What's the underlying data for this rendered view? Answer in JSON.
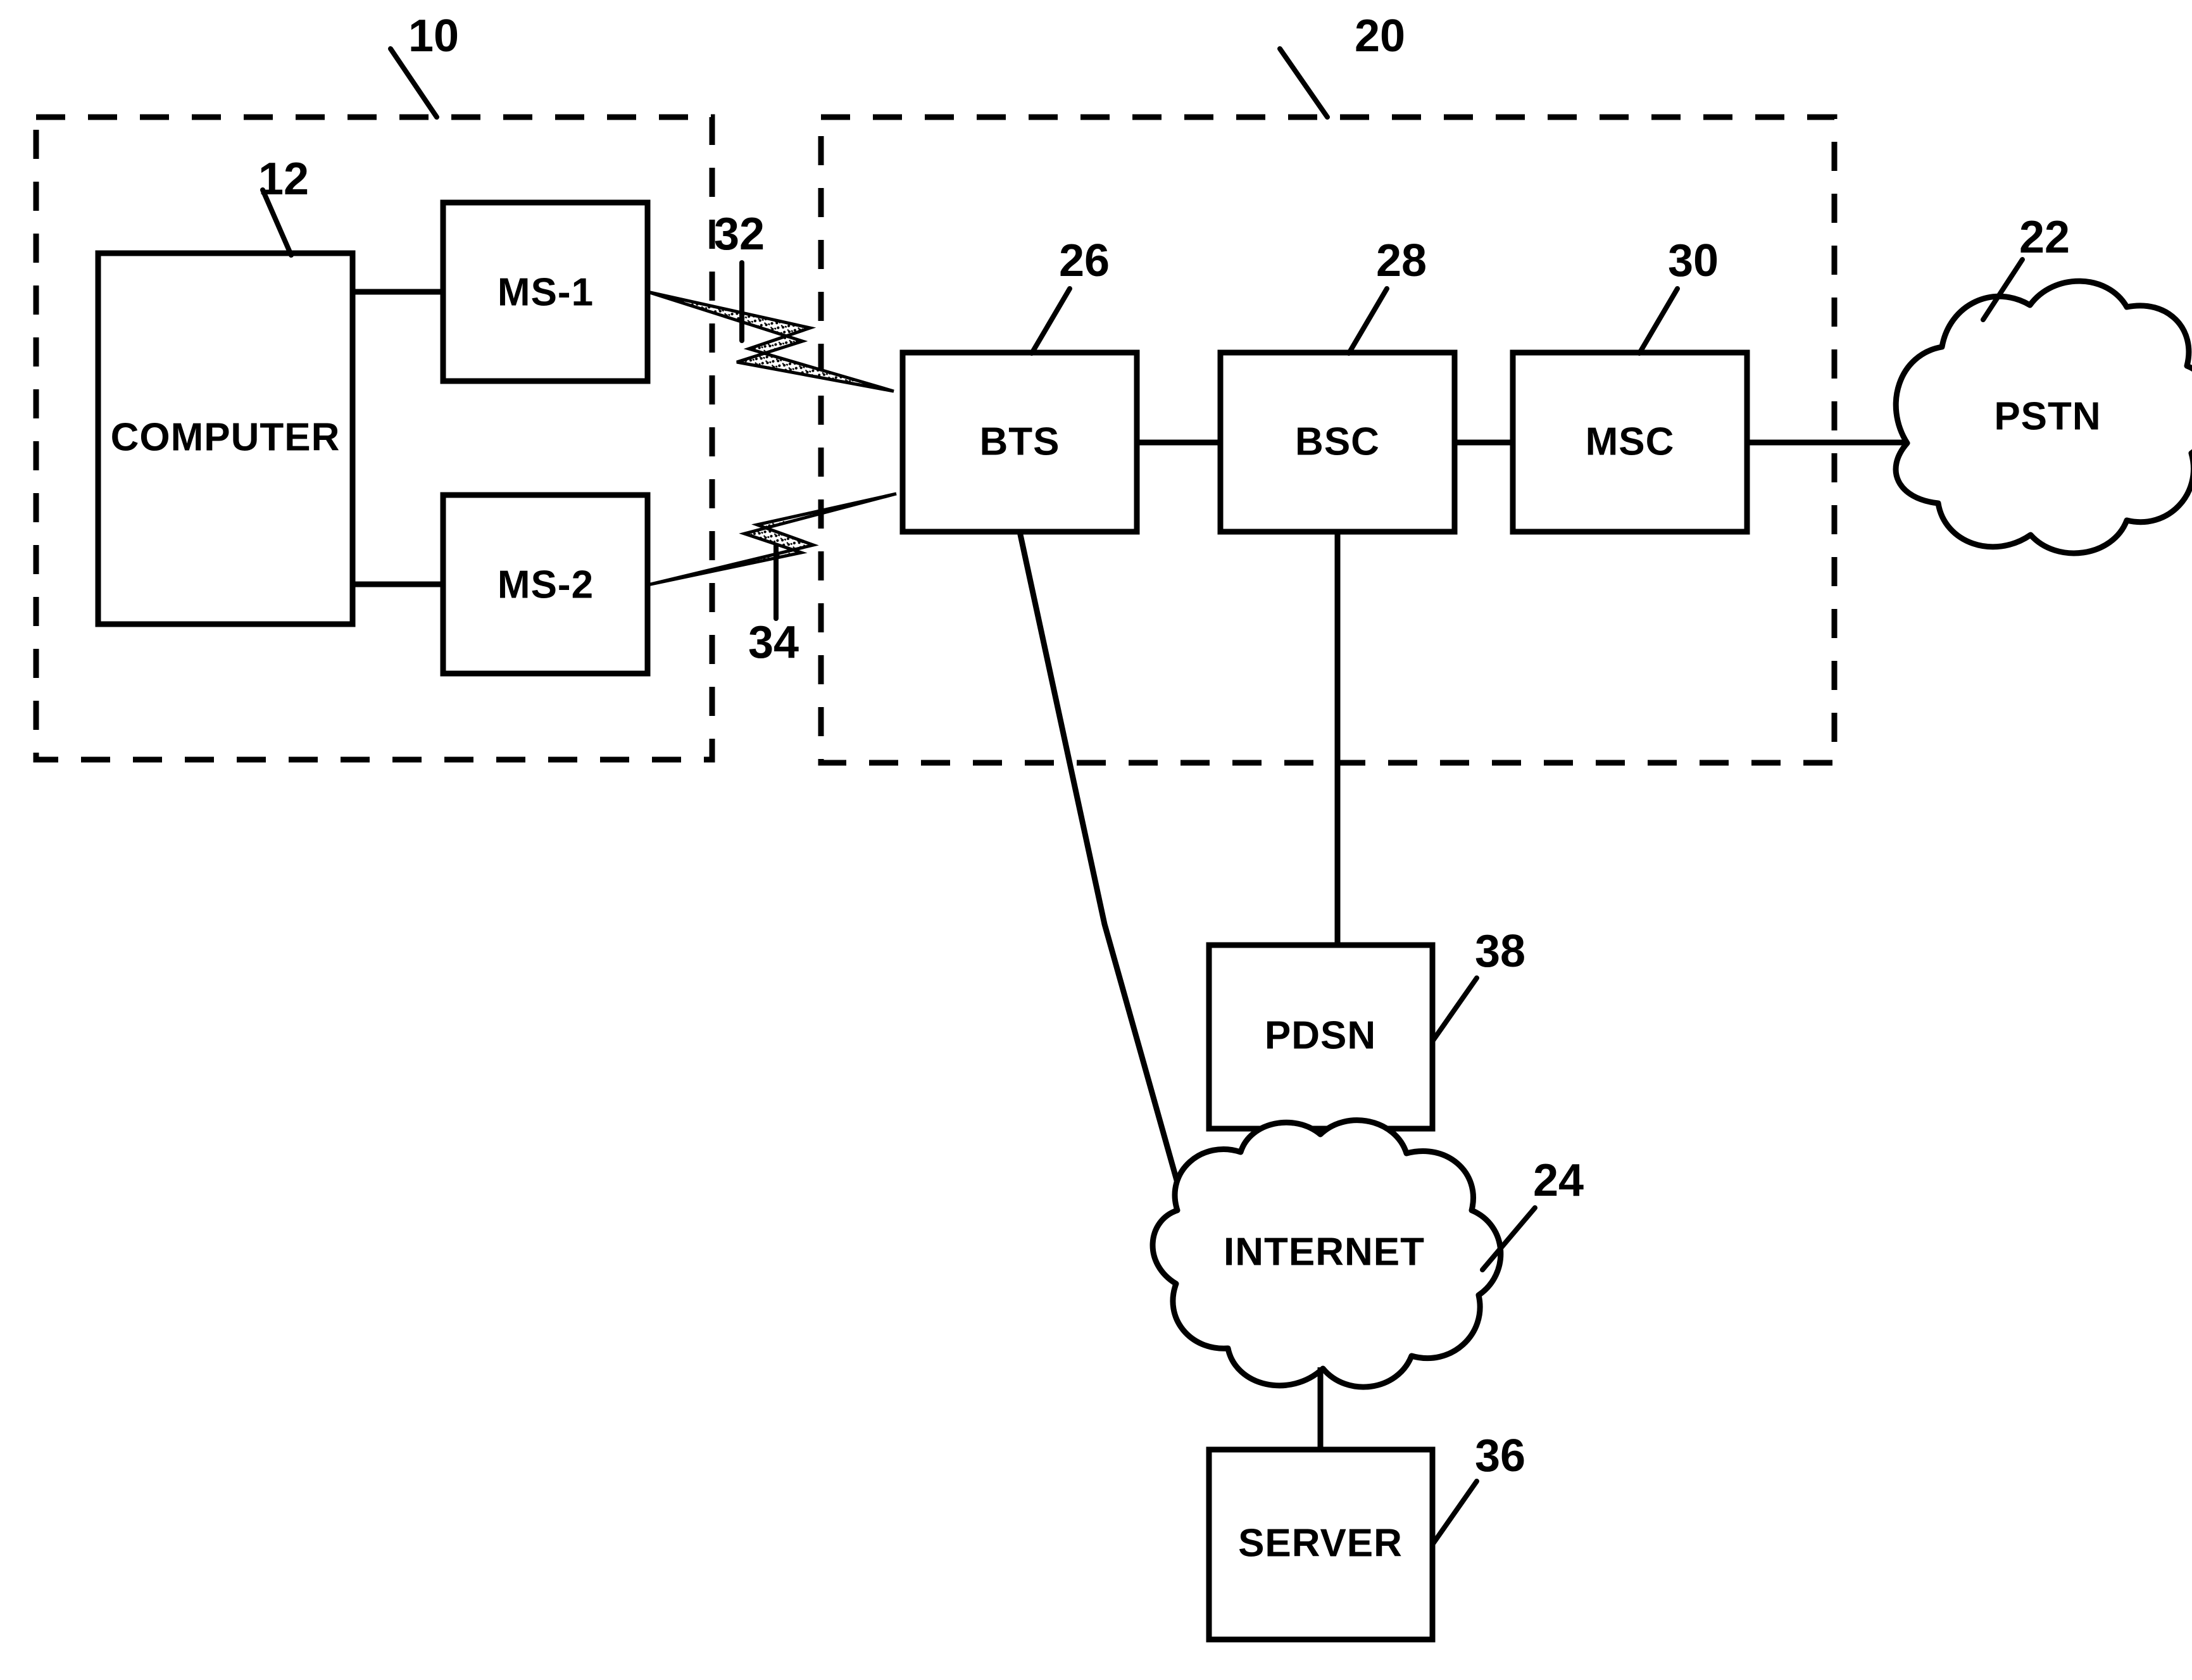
{
  "figure": {
    "type": "patent-block-diagram",
    "background_color": "#ffffff",
    "line_color": "#000000"
  },
  "regions": [
    {
      "id": "region-10",
      "ref": "10",
      "style": "dashed"
    },
    {
      "id": "region-20",
      "ref": "20",
      "style": "dashed"
    }
  ],
  "boxes": [
    {
      "id": "computer",
      "label": "COMPUTER",
      "ref": "12"
    },
    {
      "id": "ms1",
      "label": "MS-1",
      "ref": ""
    },
    {
      "id": "ms2",
      "label": "MS-2",
      "ref": ""
    },
    {
      "id": "bts",
      "label": "BTS",
      "ref": "26"
    },
    {
      "id": "bsc",
      "label": "BSC",
      "ref": "28"
    },
    {
      "id": "msc",
      "label": "MSC",
      "ref": "30"
    },
    {
      "id": "pdsn",
      "label": "PDSN",
      "ref": "38"
    },
    {
      "id": "server",
      "label": "SERVER",
      "ref": "36"
    }
  ],
  "clouds": [
    {
      "id": "pstn",
      "label": "PSTN",
      "ref": "22"
    },
    {
      "id": "internet",
      "label": "INTERNET",
      "ref": "24"
    }
  ],
  "wireless_links": [
    {
      "id": "link-32",
      "ref": "32",
      "from": "ms1",
      "to": "bts"
    },
    {
      "id": "link-34",
      "ref": "34",
      "from": "ms2",
      "to": "bts"
    }
  ],
  "reference_numerals": {
    "region_mobile": "10",
    "computer": "12",
    "region_network": "20",
    "pstn": "22",
    "internet": "24",
    "bts": "26",
    "bsc": "28",
    "msc": "30",
    "link_ms1": "32",
    "link_ms2": "34",
    "server": "36",
    "pdsn": "38"
  },
  "labels": {
    "computer": "COMPUTER",
    "ms1": "MS-1",
    "ms2": "MS-2",
    "bts": "BTS",
    "bsc": "BSC",
    "msc": "MSC",
    "pstn": "PSTN",
    "pdsn": "PDSN",
    "internet": "INTERNET",
    "server": "SERVER"
  }
}
